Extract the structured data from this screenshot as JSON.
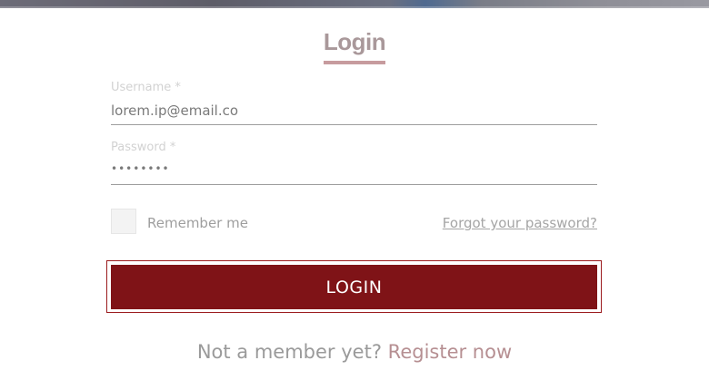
{
  "form": {
    "title": "Login",
    "username": {
      "label": "Username *",
      "value": "lorem.ip@email.co"
    },
    "password": {
      "label": "Password *",
      "value": "••••••••"
    },
    "remember_me": {
      "label": "Remember me",
      "checked": false
    },
    "forgot_password_label": "Forgot your password?",
    "submit_label": "LOGIN"
  },
  "footer": {
    "prompt": "Not a member yet?",
    "register_label": "Register now"
  },
  "colors": {
    "accent": "#7f1317",
    "title": "#a9989a",
    "title_underline": "#c79b9e",
    "register_link": "#b68f92"
  }
}
